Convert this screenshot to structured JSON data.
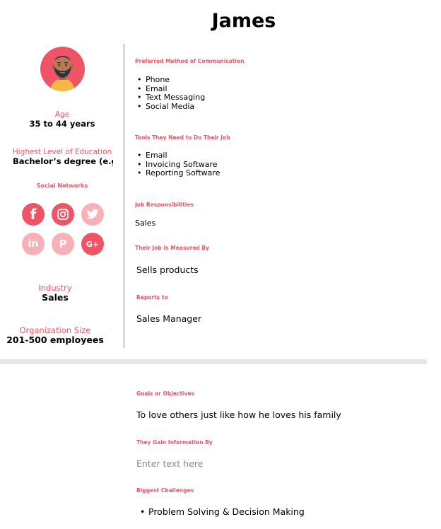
{
  "persona": {
    "name": "James"
  },
  "profile": {
    "age_label": "Age",
    "age_value": "35 to 44 years",
    "education_label": "Highest Level of Education",
    "education_value": "Bachelor’s degree (e.g. B",
    "social_label": "Social Networks",
    "industry_label": "Industry",
    "industry_value": "Sales",
    "org_size_label": "Organization Size",
    "org_size_value": "201-500 employees"
  },
  "social_networks": [
    {
      "icon": "facebook-icon",
      "glyph": "f",
      "active": true
    },
    {
      "icon": "instagram-icon",
      "glyph": "◎",
      "active": true
    },
    {
      "icon": "twitter-icon",
      "glyph": "🐦",
      "active": false
    },
    {
      "icon": "linkedin-icon",
      "glyph": "in",
      "active": false
    },
    {
      "icon": "pinterest-icon",
      "glyph": "P",
      "active": false
    },
    {
      "icon": "google-plus-icon",
      "glyph": "G+",
      "active": true
    }
  ],
  "communication": {
    "heading": "Preferred Method of Communication",
    "items": [
      "Phone",
      "Email",
      "Text Messaging",
      "Social Media"
    ]
  },
  "tools": {
    "heading": "Tools They Need to Do Their Job",
    "items": [
      "Email",
      "Invoicing Software",
      "Reporting Software"
    ]
  },
  "responsibilities": {
    "heading": "Job Responsibilities",
    "value": "Sales"
  },
  "measured_by": {
    "heading": "Their Job Is Measured By",
    "value": "Sells products"
  },
  "reports_to": {
    "heading": "Reports to",
    "value": "Sales Manager"
  },
  "goals": {
    "heading": "Goals or Objectives",
    "value": "To love others just like how he loves his family"
  },
  "information": {
    "heading": "They Gain Information By",
    "placeholder": "Enter text here"
  },
  "challenges": {
    "heading": "Biggest Challenges",
    "items": [
      "Problem Solving & Decision Making"
    ]
  },
  "colors": {
    "accent": "#ef5466",
    "accent_light": "#f7b1b6",
    "divider": "#5a86c6"
  }
}
